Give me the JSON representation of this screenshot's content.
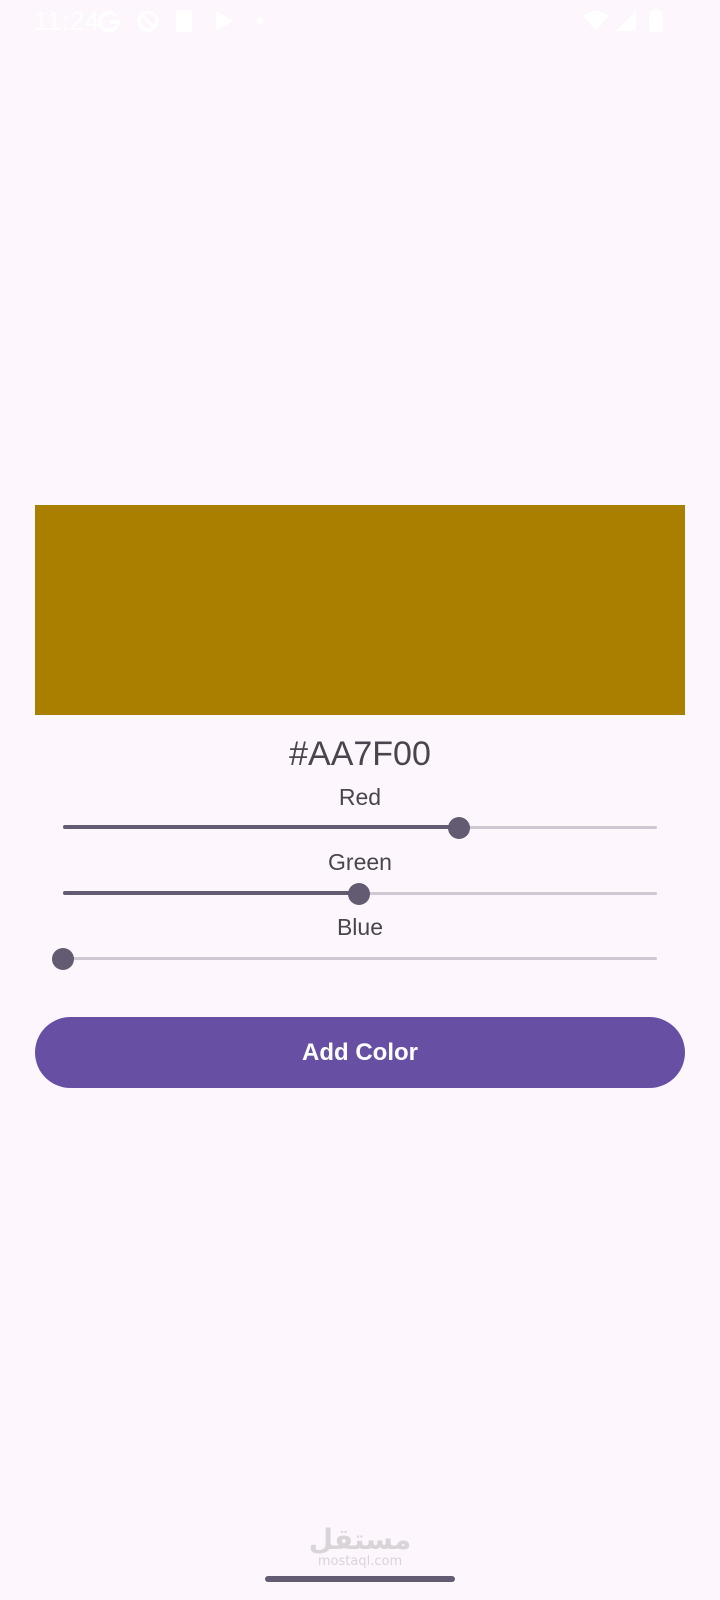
{
  "status_bar": {
    "time": "11:24",
    "icons": [
      "google-g-icon",
      "vpn-icon",
      "sim-icon",
      "play-icon",
      "dot-icon",
      "wifi-icon",
      "signal-icon",
      "battery-icon"
    ]
  },
  "preview": {
    "color": "#AA7F00"
  },
  "hex_value": "#AA7F00",
  "sliders": [
    {
      "label": "Red",
      "value": 170,
      "max": 255
    },
    {
      "label": "Green",
      "value": 127,
      "max": 255
    },
    {
      "label": "Blue",
      "value": 0,
      "max": 255
    }
  ],
  "add_button": {
    "label": "Add Color"
  },
  "watermark": {
    "main": "مستقل",
    "sub": "mostaql.com"
  },
  "colors": {
    "background": "#fdf7fd",
    "primary": "#6750a4",
    "slider_active": "#625b71",
    "slider_inactive": "#cfc7d2",
    "text": "#49454f"
  }
}
